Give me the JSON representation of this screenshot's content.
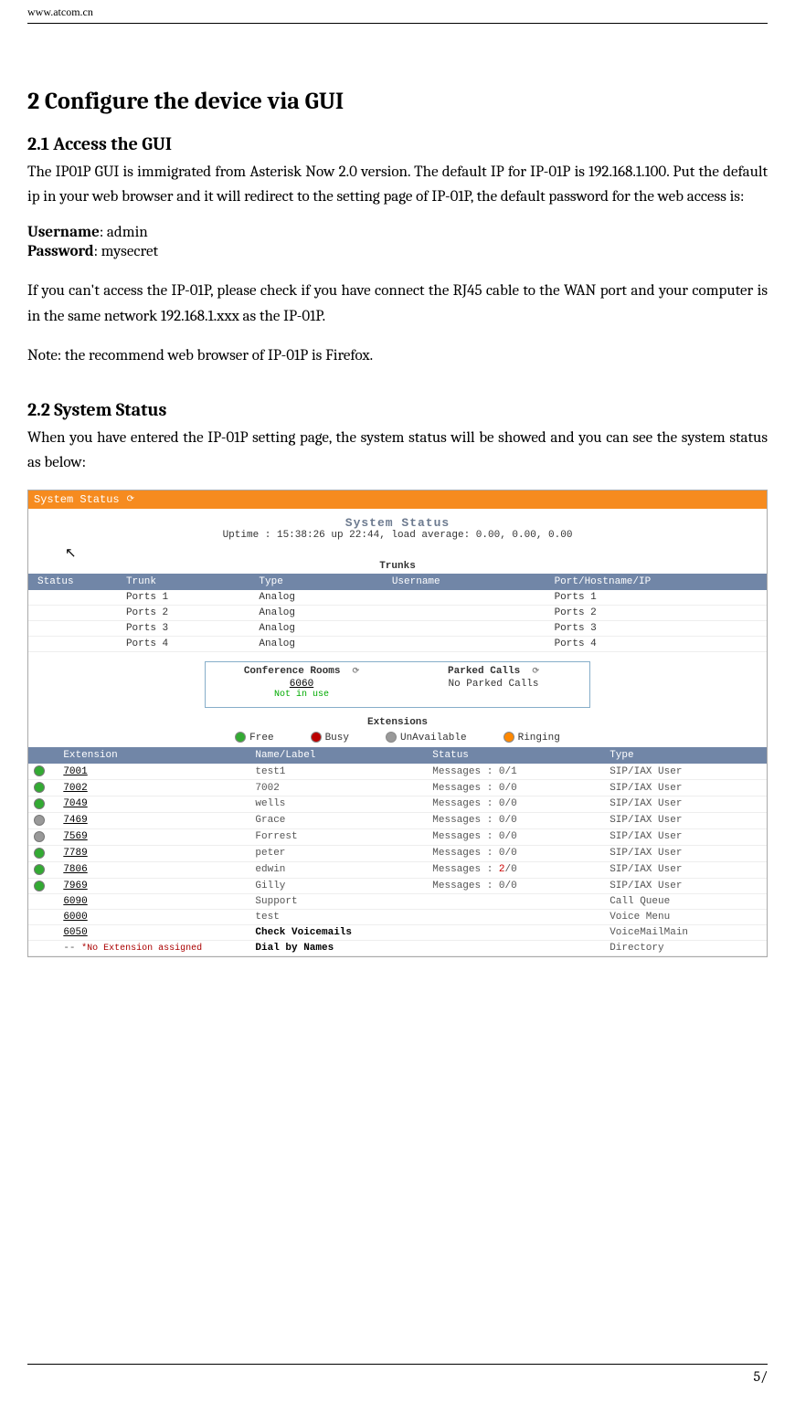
{
  "header": {
    "url": "www.atcom.cn"
  },
  "h1": "2   Configure the device via GUI",
  "h2a": "2.1 Access the GUI",
  "p1": "The IP01P GUI is immigrated from Asterisk Now 2.0 version. The default IP for IP-01P is 192.168.1.100. Put the default ip in your web browser and it will redirect to the setting page of IP-01P, the default password for the web access is:",
  "user_label": "Username",
  "user_val": ": admin",
  "pass_label": "Password",
  "pass_val": ": mysecret",
  "p2": "If you can't access the IP-01P, please check if you have connect the RJ45 cable to the WAN port and your computer is in the same network 192.168.1.xxx as the IP-01P.",
  "p3": "Note: the recommend web browser of IP-01P is Firefox.",
  "h2b": "2.2 System Status",
  "p4": "When you have entered the IP-01P setting page, the system status will be showed and you can see the system status as below:",
  "footer": {
    "page": "5/"
  },
  "ss": {
    "titlebar": "System Status",
    "heading": "System Status",
    "uptime": "Uptime : 15:38:26 up 22:44, load average: 0.00, 0.00, 0.00",
    "trunks_label": "Trunks",
    "trunks_cols": [
      "Status",
      "Trunk",
      "Type",
      "Username",
      "Port/Hostname/IP"
    ],
    "trunks": [
      {
        "status": "",
        "trunk": "Ports 1",
        "type": "Analog",
        "user": "",
        "porthost": "Ports 1"
      },
      {
        "status": "",
        "trunk": "Ports 2",
        "type": "Analog",
        "user": "",
        "porthost": "Ports 2"
      },
      {
        "status": "",
        "trunk": "Ports 3",
        "type": "Analog",
        "user": "",
        "porthost": "Ports 3"
      },
      {
        "status": "",
        "trunk": "Ports 4",
        "type": "Analog",
        "user": "",
        "porthost": "Ports 4"
      }
    ],
    "conf_title": "Conference Rooms",
    "conf_num": "6060",
    "conf_status": "Not in use",
    "parked_title": "Parked Calls",
    "parked_status": "No Parked Calls",
    "ext_label": "Extensions",
    "legend": {
      "free": "Free",
      "busy": "Busy",
      "unav": "UnAvailable",
      "ring": "Ringing"
    },
    "ext_cols": [
      "Extension",
      "Name/Label",
      "Status",
      "Type"
    ],
    "extensions": [
      {
        "dot": "free",
        "ext": "7001",
        "name": "test1",
        "status": "Messages : 0/1",
        "type": "SIP/IAX User"
      },
      {
        "dot": "free",
        "ext": "7002",
        "name": "7002",
        "status": "Messages : 0/0",
        "type": "SIP/IAX User"
      },
      {
        "dot": "free",
        "ext": "7049",
        "name": "wells",
        "status": "Messages : 0/0",
        "type": "SIP/IAX User"
      },
      {
        "dot": "unav",
        "ext": "7469",
        "name": "Grace",
        "status": "Messages : 0/0",
        "type": "SIP/IAX User"
      },
      {
        "dot": "unav",
        "ext": "7569",
        "name": "Forrest",
        "status": "Messages : 0/0",
        "type": "SIP/IAX User"
      },
      {
        "dot": "free",
        "ext": "7789",
        "name": "peter",
        "status": "Messages : 0/0",
        "type": "SIP/IAX User"
      },
      {
        "dot": "free",
        "ext": "7806",
        "name": "edwin",
        "status_pre": "Messages : ",
        "status_red": "2",
        "status_post": "/0",
        "type": "SIP/IAX User"
      },
      {
        "dot": "free",
        "ext": "7969",
        "name": "Gilly",
        "status": "Messages : 0/0",
        "type": "SIP/IAX User"
      },
      {
        "dot": "",
        "ext": "6090",
        "name": "Support",
        "status": "",
        "type": "Call Queue"
      },
      {
        "dot": "",
        "ext": "6000",
        "name": "test",
        "status": "",
        "type": "Voice Menu"
      },
      {
        "dot": "",
        "ext": "6050",
        "name": "Check Voicemails",
        "name_bold": true,
        "status": "",
        "type": "VoiceMailMain"
      },
      {
        "dot": "",
        "ext": "--",
        "ext_plain": true,
        "star": "*No Extension assigned",
        "name": "Dial by Names",
        "name_bold": true,
        "status": "",
        "type": "Directory"
      }
    ]
  }
}
